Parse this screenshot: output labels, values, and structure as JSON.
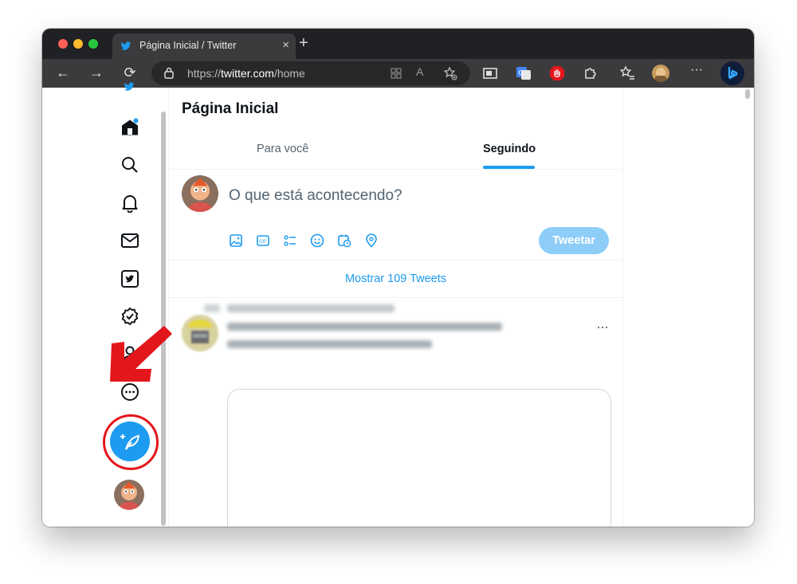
{
  "browser": {
    "tab_title": "Página Inicial / Twitter",
    "tab_close": "×",
    "new_tab": "+",
    "url_scheme": "https://",
    "url_host": "twitter.com",
    "url_path": "/home",
    "reader_icon": "reader-icon",
    "read_aloud_label": "A",
    "back": "←",
    "forward": "→",
    "reload": "⟳",
    "more": "···"
  },
  "sidebar": {
    "items": [
      {
        "name": "home-icon"
      },
      {
        "name": "explore-icon"
      },
      {
        "name": "notifications-icon"
      },
      {
        "name": "messages-icon"
      },
      {
        "name": "twitter-blue-icon"
      },
      {
        "name": "verified-icon"
      },
      {
        "name": "profile-icon"
      },
      {
        "name": "more-icon"
      }
    ],
    "compose_icon": "feather-plus-icon"
  },
  "main": {
    "title": "Página Inicial",
    "tabs": [
      {
        "label": "Para você",
        "active": false
      },
      {
        "label": "Seguindo",
        "active": true
      }
    ],
    "compose_placeholder": "O que está acontecendo?",
    "tweet_button": "Tweetar",
    "show_tweets": "Mostrar 109 Tweets",
    "more_menu": "···"
  },
  "colors": {
    "accent": "#1d9bf0",
    "tweet_button_disabled": "#8ecdf8",
    "annotation_red": "#e3161c",
    "browser_dark": "#202124"
  }
}
